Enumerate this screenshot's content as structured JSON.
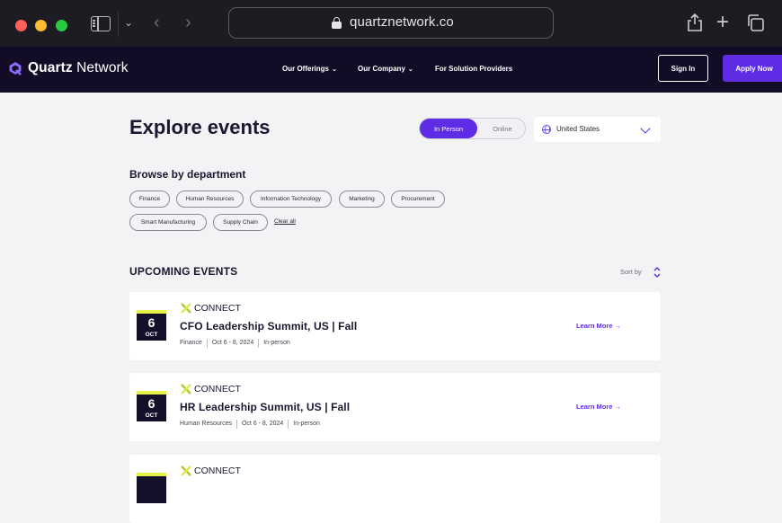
{
  "browser": {
    "url": "quartznetwork.co"
  },
  "site": {
    "brand_bold": "Quartz",
    "brand_light": " Network",
    "menu": [
      {
        "label": "Our Offerings",
        "has_dropdown": true
      },
      {
        "label": "Our Company",
        "has_dropdown": true
      },
      {
        "label": "For Solution Providers",
        "has_dropdown": false
      }
    ],
    "sign_in": "Sign In",
    "apply_now": "Apply Now",
    "accent_color": "#5e2ce4"
  },
  "explore": {
    "title": "Explore events",
    "toggle": {
      "in_person": "In Person",
      "online": "Online",
      "selected": "In Person"
    },
    "country": "United States"
  },
  "departments": {
    "heading": "Browse by department",
    "chips": [
      "Finance",
      "Human Resources",
      "Information Technology",
      "Marketing",
      "Procurement",
      "Smart Manufacturing",
      "Supply Chain"
    ],
    "clear_all": "Clear all"
  },
  "upcoming": {
    "heading": "UPCOMING EVENTS",
    "sort_label": "Sort by",
    "events": [
      {
        "day": "6",
        "month": "OCT",
        "brand": "CONNECT",
        "title": "CFO Leadership Summit, US | Fall",
        "department": "Finance",
        "dates": "Oct 6 - 8, 2024",
        "format": "In-person",
        "cta": "Learn More →"
      },
      {
        "day": "6",
        "month": "OCT",
        "brand": "CONNECT",
        "title": "HR Leadership Summit, US | Fall",
        "department": "Human Resources",
        "dates": "Oct 6 - 8, 2024",
        "format": "In-person",
        "cta": "Learn More →"
      },
      {
        "day": "",
        "month": "",
        "brand": "CONNECT",
        "title": "",
        "department": "",
        "dates": "",
        "format": "",
        "cta": ""
      }
    ]
  }
}
